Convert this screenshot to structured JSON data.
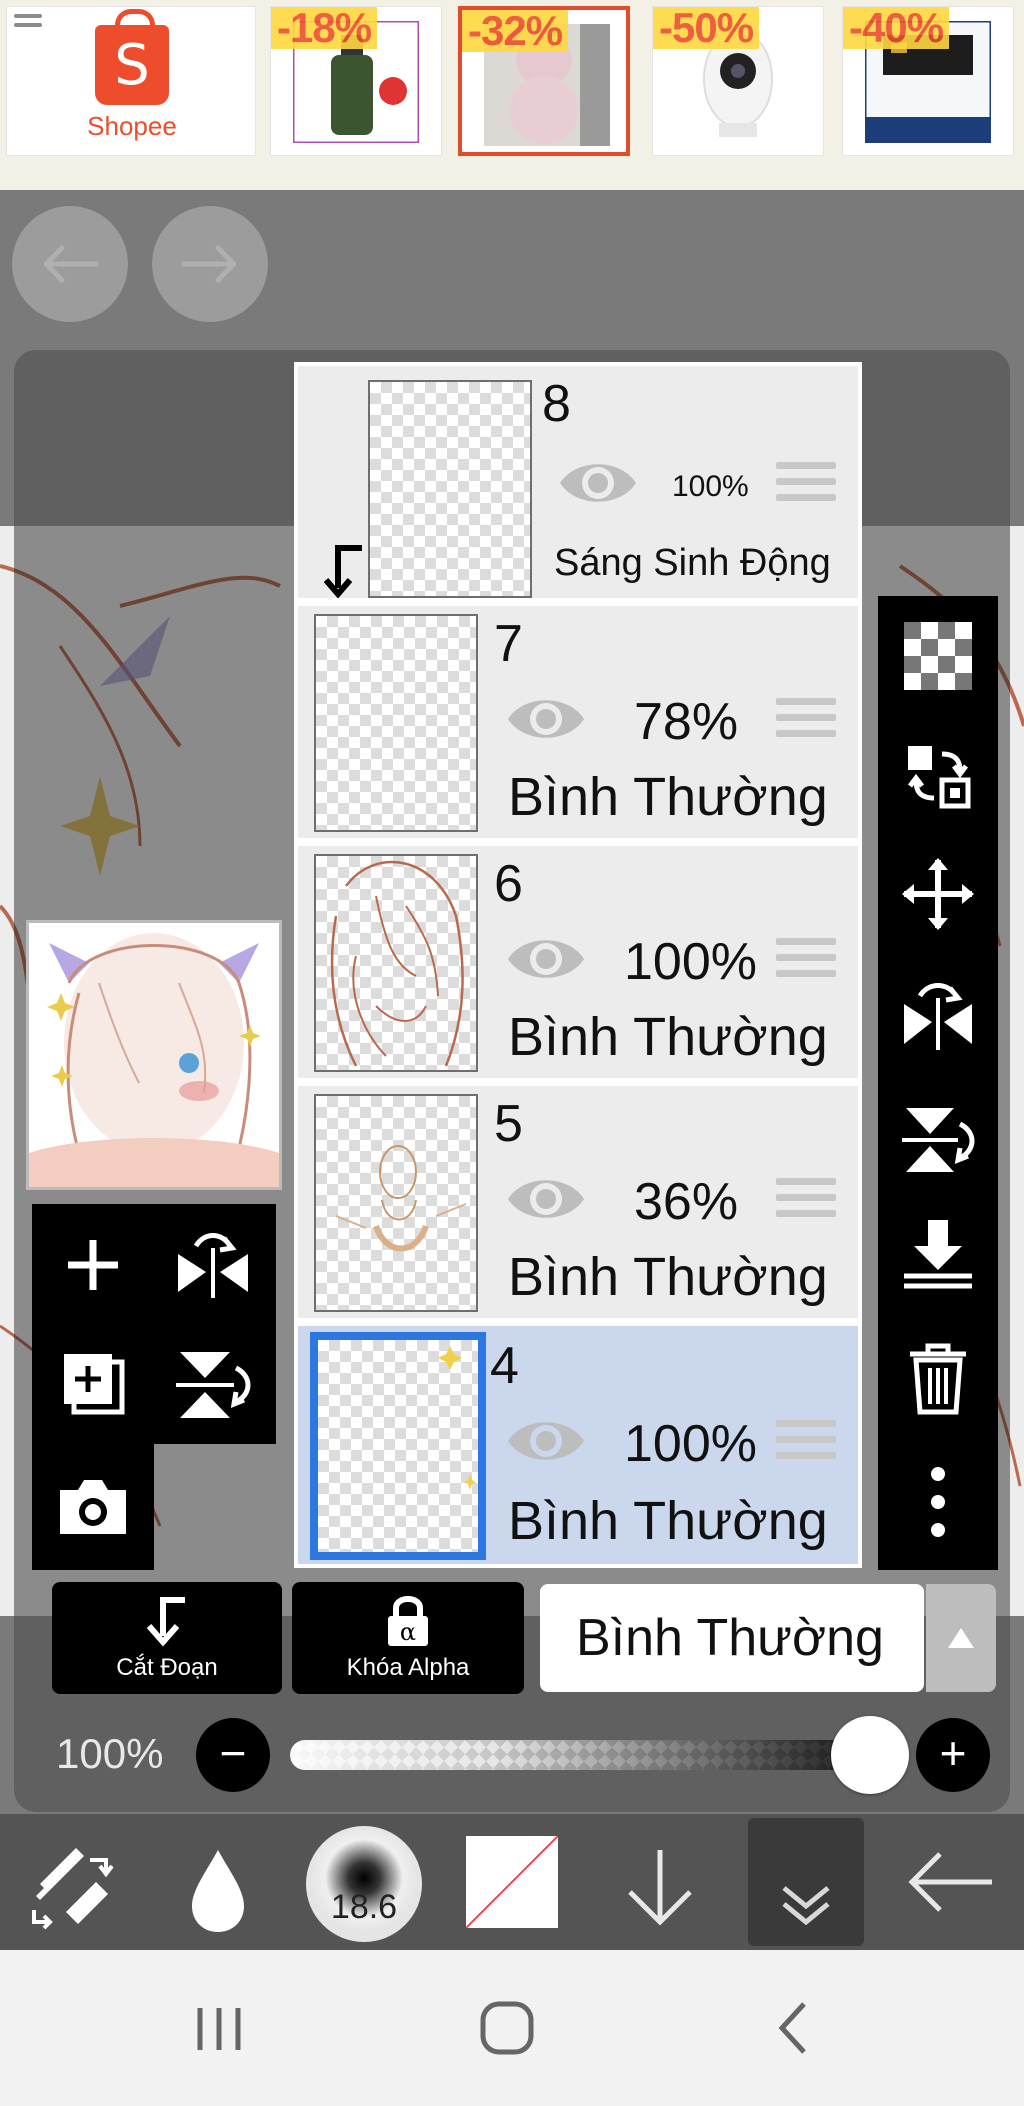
{
  "ad": {
    "brand": "Shopee",
    "products": [
      {
        "discount": "-18%"
      },
      {
        "discount": "-32%"
      },
      {
        "discount": "-50%"
      },
      {
        "discount": "-40%"
      }
    ]
  },
  "layers": [
    {
      "number": "8",
      "opacity": "100%",
      "blend": "Sáng Sinh Động"
    },
    {
      "number": "7",
      "opacity": "78%",
      "blend": "Bình Thường"
    },
    {
      "number": "6",
      "opacity": "100%",
      "blend": "Bình Thường"
    },
    {
      "number": "5",
      "opacity": "36%",
      "blend": "Bình Thường"
    },
    {
      "number": "4",
      "opacity": "100%",
      "blend": "Bình Thường"
    }
  ],
  "controls": {
    "clipping_label": "Cắt Đoạn",
    "alpha_lock_label": "Khóa Alpha",
    "blend_mode": "Bình Thường",
    "opacity_label": "100%",
    "opacity_value": 1.0
  },
  "toolbar": {
    "brush_size": "18.6",
    "colors": {
      "active_border": "#2d78e0",
      "accent": "#ee4d2d"
    }
  }
}
